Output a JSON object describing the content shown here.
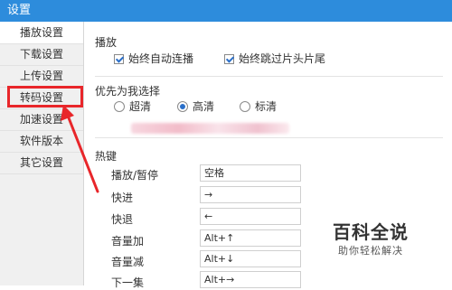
{
  "window": {
    "title": "设置"
  },
  "sidebar": {
    "items": [
      {
        "label": "播放设置"
      },
      {
        "label": "下载设置"
      },
      {
        "label": "上传设置"
      },
      {
        "label": "转码设置"
      },
      {
        "label": "加速设置"
      },
      {
        "label": "软件版本"
      },
      {
        "label": "其它设置"
      }
    ]
  },
  "playback": {
    "title": "播放",
    "auto_continue_label": "始终自动连播",
    "skip_intro_label": "始终跳过片头片尾"
  },
  "quality": {
    "title": "优先为我选择",
    "options": [
      {
        "label": "超清",
        "selected": false
      },
      {
        "label": "高清",
        "selected": true
      },
      {
        "label": "标清",
        "selected": false
      }
    ]
  },
  "hotkeys": {
    "title": "热键",
    "rows": [
      {
        "label": "播放/暂停",
        "value": "空格"
      },
      {
        "label": "快进",
        "value": "→"
      },
      {
        "label": "快退",
        "value": "←"
      },
      {
        "label": "音量加",
        "value": "Alt+↑"
      },
      {
        "label": "音量减",
        "value": "Alt+↓"
      },
      {
        "label": "下一集",
        "value": "Alt+→"
      }
    ]
  },
  "watermark": {
    "main": "百科全说",
    "sub": "助你轻松解决"
  },
  "colors": {
    "titlebar": "#2d8cdc",
    "highlight": "#e8262a",
    "accent": "#2a6fc9"
  }
}
